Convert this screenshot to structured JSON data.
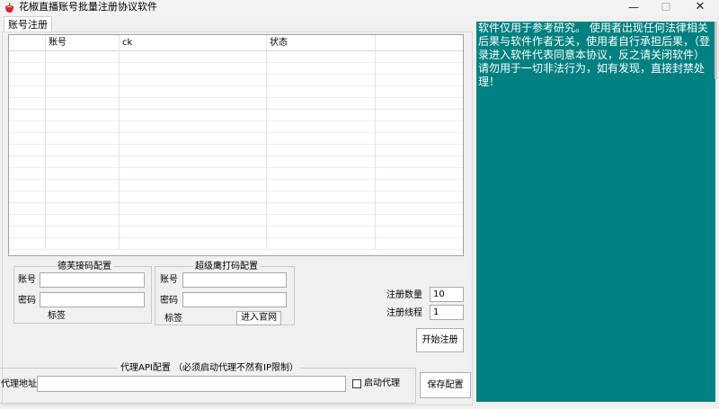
{
  "window": {
    "title": "花椒直播账号批量注册协议软件",
    "minimize_glyph": "—",
    "maximize_glyph": "☐",
    "close_glyph": "✕"
  },
  "tabs": [
    {
      "label": "账号注册"
    }
  ],
  "table": {
    "columns": [
      "",
      "账号",
      "ck",
      "状态",
      ""
    ],
    "rows": []
  },
  "group_dexiao": {
    "title": "德芙接码配置",
    "account_label": "账号",
    "account_value": "",
    "password_label": "密码",
    "password_value": "",
    "tag_label": "标签"
  },
  "group_chaoji": {
    "title": "超级鹰打码配置",
    "account_label": "账号",
    "account_value": "",
    "password_label": "密码",
    "password_value": "",
    "tag_label": "标签",
    "website_button": "进入官网"
  },
  "register": {
    "count_label": "注册数量",
    "count_value": "10",
    "threads_label": "注册线程",
    "threads_value": "1",
    "start_button": "开始注册"
  },
  "proxy": {
    "group_title": "代理API配置 （必须启动代理不然有IP限制）",
    "address_label": "代理地址",
    "address_value": "",
    "enable_label": "启动代理",
    "enable_checked": false,
    "save_button": "保存配置"
  },
  "notice": {
    "text": "软件仅用于参考研究。 使用者出现任何法律相关后果与软件作者无关，使用者自行承担后果，（登录进入软件代表同意本协议，反之请关闭软件）请勿用于一切非法行为，如有发现，直接封禁处理！"
  },
  "colors": {
    "notice_background": "#008080",
    "window_background": "#f0f0f0"
  }
}
